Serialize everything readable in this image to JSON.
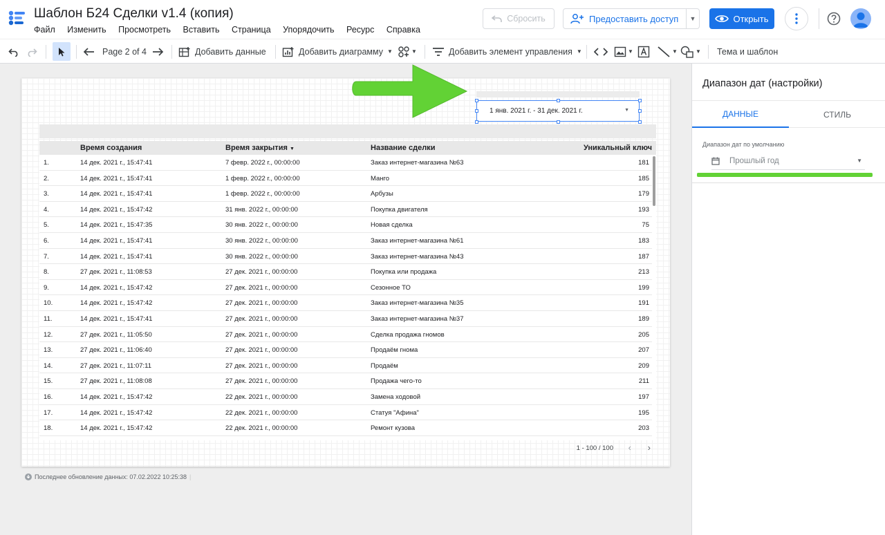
{
  "header": {
    "title": "Шаблон Б24 Сделки v1.4 (копия)",
    "menu": [
      "Файл",
      "Изменить",
      "Просмотреть",
      "Вставить",
      "Страница",
      "Упорядочить",
      "Ресурс",
      "Справка"
    ],
    "reset_label": "Сбросить",
    "share_label": "Предоставить доступ",
    "open_label": "Открыть"
  },
  "toolbar": {
    "page_indicator": "Page 2 of 4",
    "add_data": "Добавить данные",
    "add_chart": "Добавить диаграмму",
    "add_control": "Добавить элемент управления",
    "theme": "Тема и шаблон"
  },
  "report": {
    "date_range": "1 янв. 2021 г. - 31 дек. 2021 г.",
    "table": {
      "columns": [
        "Время создания",
        "Время закрытия",
        "Название сделки",
        "Уникальный ключ"
      ],
      "rows": [
        [
          "1.",
          "14 дек. 2021 г., 15:47:41",
          "7 февр. 2022 г., 00:00:00",
          "Заказ интернет-магазина №63",
          "181"
        ],
        [
          "2.",
          "14 дек. 2021 г., 15:47:41",
          "1 февр. 2022 г., 00:00:00",
          "Манго",
          "185"
        ],
        [
          "3.",
          "14 дек. 2021 г., 15:47:41",
          "1 февр. 2022 г., 00:00:00",
          "Арбузы",
          "179"
        ],
        [
          "4.",
          "14 дек. 2021 г., 15:47:42",
          "31 янв. 2022 г., 00:00:00",
          "Покупка двигателя",
          "193"
        ],
        [
          "5.",
          "14 дек. 2021 г., 15:47:35",
          "30 янв. 2022 г., 00:00:00",
          "Новая сделка",
          "75"
        ],
        [
          "6.",
          "14 дек. 2021 г., 15:47:41",
          "30 янв. 2022 г., 00:00:00",
          "Заказ интернет-магазина №61",
          "183"
        ],
        [
          "7.",
          "14 дек. 2021 г., 15:47:41",
          "30 янв. 2022 г., 00:00:00",
          "Заказ интернет-магазина №43",
          "187"
        ],
        [
          "8.",
          "27 дек. 2021 г., 11:08:53",
          "27 дек. 2021 г., 00:00:00",
          "Покупка или продажа",
          "213"
        ],
        [
          "9.",
          "14 дек. 2021 г., 15:47:42",
          "27 дек. 2021 г., 00:00:00",
          "Сезонное ТО",
          "199"
        ],
        [
          "10.",
          "14 дек. 2021 г., 15:47:42",
          "27 дек. 2021 г., 00:00:00",
          "Заказ интернет-магазина №35",
          "191"
        ],
        [
          "11.",
          "14 дек. 2021 г., 15:47:41",
          "27 дек. 2021 г., 00:00:00",
          "Заказ интернет-магазина №37",
          "189"
        ],
        [
          "12.",
          "27 дек. 2021 г., 11:05:50",
          "27 дек. 2021 г., 00:00:00",
          "Сделка продажа гномов",
          "205"
        ],
        [
          "13.",
          "27 дек. 2021 г., 11:06:40",
          "27 дек. 2021 г., 00:00:00",
          "Продаём гнома",
          "207"
        ],
        [
          "14.",
          "27 дек. 2021 г., 11:07:11",
          "27 дек. 2021 г., 00:00:00",
          "Продаём",
          "209"
        ],
        [
          "15.",
          "27 дек. 2021 г., 11:08:08",
          "27 дек. 2021 г., 00:00:00",
          "Продажа чего-то",
          "211"
        ],
        [
          "16.",
          "14 дек. 2021 г., 15:47:42",
          "22 дек. 2021 г., 00:00:00",
          "Замена ходовой",
          "197"
        ],
        [
          "17.",
          "14 дек. 2021 г., 15:47:42",
          "22 дек. 2021 г., 00:00:00",
          "Статуя \"Афина\"",
          "195"
        ],
        [
          "18.",
          "14 дек. 2021 г., 15:47:42",
          "22 дек. 2021 г., 00:00:00",
          "Ремонт кузова",
          "203"
        ]
      ],
      "pagination": "1 - 100 / 100"
    },
    "last_update": "Последнее обновление данных: 07.02.2022 10:25:38"
  },
  "panel": {
    "title": "Диапазон дат (настройки)",
    "tabs": [
      "ДАННЫЕ",
      "СТИЛЬ"
    ],
    "default_range_label": "Диапазон дат по умолчанию",
    "default_range_value": "Прошлый год"
  },
  "colors": {
    "accent": "#1a73e8",
    "highlight_green": "#62d235"
  }
}
